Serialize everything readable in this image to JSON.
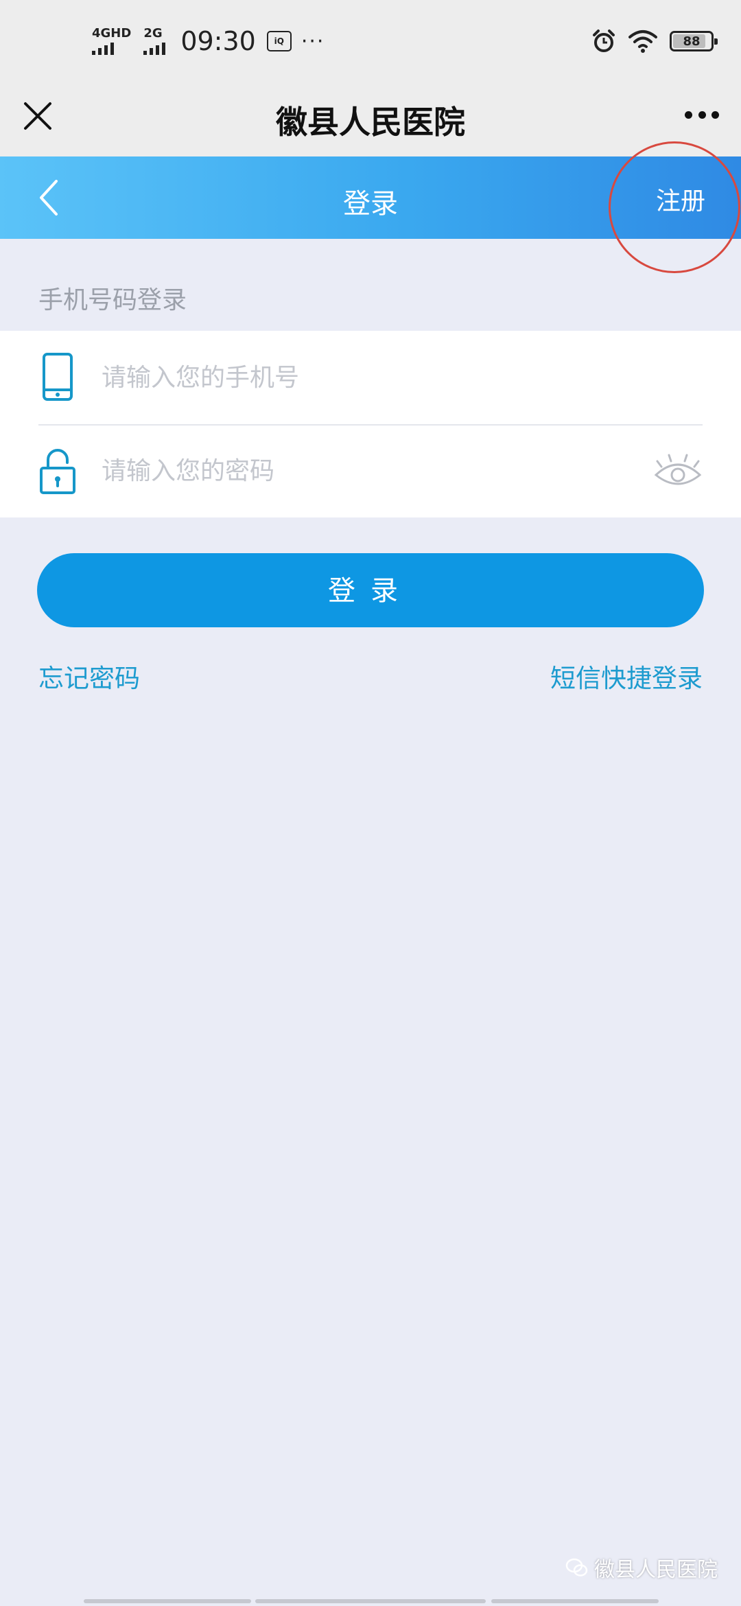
{
  "status_bar": {
    "signal1_label": "4GHD",
    "signal2_label": "2G",
    "time": "09:30",
    "app_badge": "iQIYI",
    "more": "···",
    "battery": "88",
    "battery_level": 0.88
  },
  "title_bar": {
    "title": "徽县人民医院"
  },
  "nav": {
    "title": "登录",
    "register": "注册"
  },
  "login": {
    "section_label": "手机号码登录",
    "phone_placeholder": "请输入您的手机号",
    "phone_value": "",
    "password_placeholder": "请输入您的密码",
    "password_value": "",
    "submit": "登录",
    "forgot_password": "忘记密码",
    "sms_login": "短信快捷登录"
  },
  "watermark": {
    "text": "徽县人民医院"
  },
  "colors": {
    "nav_gradient_start": "#5bc3f8",
    "nav_gradient_end": "#2f8ae4",
    "primary_button": "#0e97e3",
    "link": "#1d9bcf",
    "annotation_circle": "#d8493f",
    "background": "#eaecf6"
  },
  "icons": {
    "close": "close-icon",
    "more": "more-dots-icon",
    "back": "chevron-left-icon",
    "phone": "phone-icon",
    "lock": "lock-icon",
    "eye": "eye-icon",
    "alarm": "alarm-icon",
    "wifi": "wifi-icon",
    "wechat": "wechat-icon"
  }
}
